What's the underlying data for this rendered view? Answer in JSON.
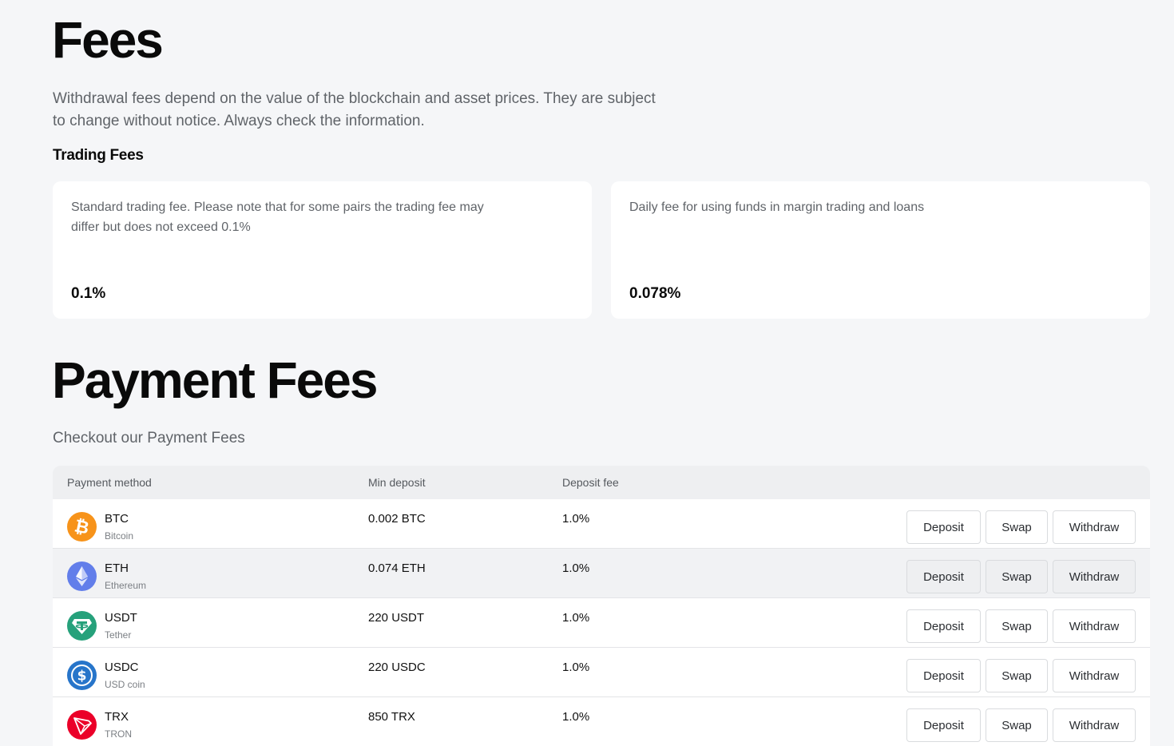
{
  "fees": {
    "title": "Fees",
    "description": "Withdrawal fees depend on the value of the blockchain and asset prices. They are subject to change without notice. Always check the information."
  },
  "trading": {
    "title": "Trading Fees",
    "cards": [
      {
        "text": "Standard trading fee. Please note that for some pairs the trading fee may differ but does not exceed 0.1%",
        "value": "0.1%"
      },
      {
        "text": "Daily fee for using funds in margin trading and loans",
        "value": "0.078%"
      }
    ]
  },
  "payment": {
    "title": "Payment Fees",
    "subtitle": "Checkout our Payment Fees",
    "columns": [
      "Payment method",
      "Min deposit",
      "Deposit fee"
    ],
    "buttons": {
      "deposit": "Deposit",
      "swap": "Swap",
      "withdraw": "Withdraw"
    },
    "rows": [
      {
        "symbol": "BTC",
        "name": "Bitcoin",
        "min": "0.002 BTC",
        "fee": "1.0%",
        "icon": "bitcoin-icon",
        "color": "#f7931a"
      },
      {
        "symbol": "ETH",
        "name": "Ethereum",
        "min": "0.074 ETH",
        "fee": "1.0%",
        "icon": "ethereum-icon",
        "color": "#627eea"
      },
      {
        "symbol": "USDT",
        "name": "Tether",
        "min": "220 USDT",
        "fee": "1.0%",
        "icon": "tether-icon",
        "color": "#26a17b"
      },
      {
        "symbol": "USDC",
        "name": "USD coin",
        "min": "220 USDC",
        "fee": "1.0%",
        "icon": "usdc-icon",
        "color": "#2775ca"
      },
      {
        "symbol": "TRX",
        "name": "TRON",
        "min": "850 TRX",
        "fee": "1.0%",
        "icon": "tron-icon",
        "color": "#eb0029"
      }
    ]
  }
}
